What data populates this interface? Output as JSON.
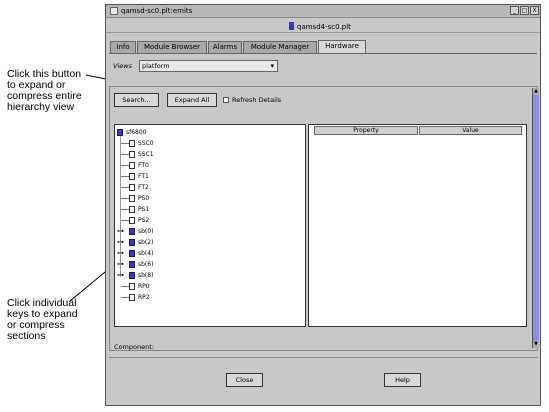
{
  "callouts": {
    "expand_all": "Click this button\nto expand or\ncompress  entire\nhierarchy  view",
    "keys": "Click  individual\nkeys to expand\nor compress\nsections"
  },
  "window": {
    "wm_title": "qamsd-sc0.plt:emits",
    "title": "qamsd4-sc0.plt",
    "buttons": [
      "_",
      "□",
      "X"
    ]
  },
  "tabs": [
    "Info",
    "Module Browser",
    "Alarms",
    "Module Manager",
    "Hardware"
  ],
  "active_tab": "Hardware",
  "views": {
    "label": "Views",
    "value": "platform"
  },
  "toolbar": {
    "search": "Search...",
    "expand_all": "Expand All",
    "refresh_details": "Refresh Details"
  },
  "tree": {
    "icons": {
      "root": "folder-icon",
      "leaf": "file-icon",
      "group": "folder-icon"
    },
    "nodes": [
      {
        "label": "sf6800",
        "kind": "root"
      },
      {
        "label": "SSC0",
        "kind": "leaf"
      },
      {
        "label": "SSC1",
        "kind": "leaf"
      },
      {
        "label": "FT0",
        "kind": "leaf"
      },
      {
        "label": "FT1",
        "kind": "leaf"
      },
      {
        "label": "FT2",
        "kind": "leaf"
      },
      {
        "label": "PS0",
        "kind": "leaf"
      },
      {
        "label": "PS1",
        "kind": "leaf"
      },
      {
        "label": "PS2",
        "kind": "leaf"
      },
      {
        "label": "sb(0)",
        "kind": "group"
      },
      {
        "label": "sb(2)",
        "kind": "group"
      },
      {
        "label": "sb(4)",
        "kind": "group"
      },
      {
        "label": "sb(6)",
        "kind": "group"
      },
      {
        "label": "sb(8)",
        "kind": "group"
      },
      {
        "label": "RP0",
        "kind": "leaf"
      },
      {
        "label": "RP2",
        "kind": "leaf"
      }
    ]
  },
  "properties": {
    "columns": [
      "Property",
      "Value"
    ]
  },
  "component_label": "Component:",
  "footer": {
    "close": "Close",
    "help": "Help"
  },
  "colors": {
    "window_bg": "#c8c8c8",
    "scrollbar": "#8c8ce0",
    "folder": "#3b3bb0"
  }
}
